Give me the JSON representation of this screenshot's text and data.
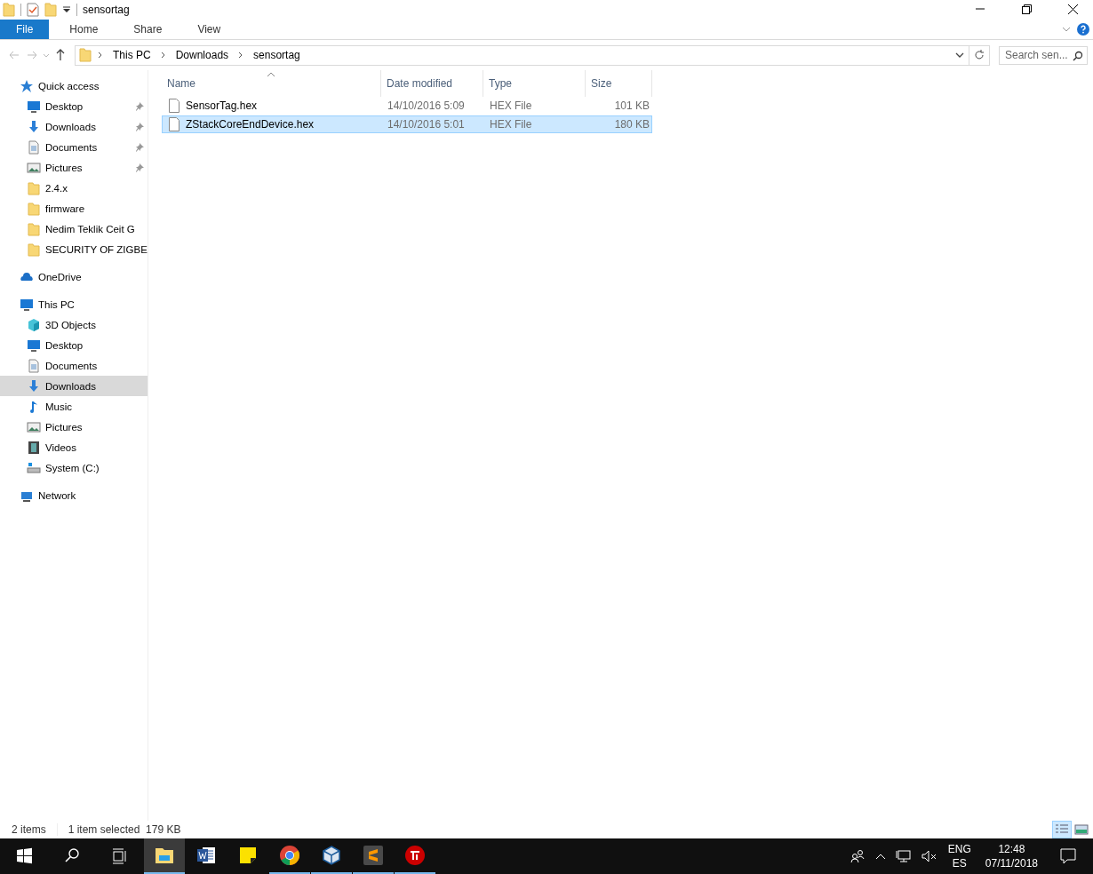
{
  "window": {
    "title": "sensortag"
  },
  "quick_access_toolbar": [
    {
      "kind": "properties"
    },
    {
      "kind": "new-folder"
    },
    {
      "kind": "customize"
    }
  ],
  "ribbon": {
    "tabs": [
      {
        "label": "File",
        "kind": "file",
        "selected": false
      },
      {
        "label": "Home",
        "kind": "tab",
        "selected": false
      },
      {
        "label": "Share",
        "kind": "tab",
        "selected": false
      },
      {
        "label": "View",
        "kind": "tab",
        "selected": false
      }
    ]
  },
  "address_bar": {
    "path": [
      "This PC",
      "Downloads",
      "sensortag"
    ]
  },
  "search": {
    "placeholder": "Search sen..."
  },
  "sidebar": {
    "items": [
      {
        "label": "Quick access",
        "kind": "star",
        "selected": false,
        "children": [
          {
            "label": "Desktop",
            "kind": "desktop",
            "pinned": true,
            "selected": false
          },
          {
            "label": "Downloads",
            "kind": "download",
            "pinned": true,
            "selected": false
          },
          {
            "label": "Documents",
            "kind": "document",
            "pinned": true,
            "selected": false
          },
          {
            "label": "Pictures",
            "kind": "picture",
            "pinned": true,
            "selected": false
          },
          {
            "label": "2.4.x",
            "kind": "folder",
            "pinned": false,
            "selected": false
          },
          {
            "label": "firmware",
            "kind": "folder",
            "pinned": false,
            "selected": false
          },
          {
            "label": "Nedim Teklik Ceit G",
            "kind": "folder",
            "pinned": false,
            "selected": false
          },
          {
            "label": "SECURITY OF ZIGBE",
            "kind": "folder",
            "pinned": false,
            "selected": false
          }
        ]
      },
      {
        "label": "OneDrive",
        "kind": "cloud",
        "selected": false
      },
      {
        "label": "This PC",
        "kind": "computer",
        "selected": false,
        "children": [
          {
            "label": "3D Objects",
            "kind": "cube",
            "selected": false
          },
          {
            "label": "Desktop",
            "kind": "desktop",
            "selected": false
          },
          {
            "label": "Documents",
            "kind": "document",
            "selected": false
          },
          {
            "label": "Downloads",
            "kind": "download",
            "selected": true
          },
          {
            "label": "Music",
            "kind": "music",
            "selected": false
          },
          {
            "label": "Pictures",
            "kind": "picture",
            "selected": false
          },
          {
            "label": "Videos",
            "kind": "video",
            "selected": false
          },
          {
            "label": "System (C:)",
            "kind": "drive",
            "selected": false
          }
        ]
      },
      {
        "label": "Network",
        "kind": "network",
        "selected": false
      }
    ]
  },
  "table": {
    "columns": [
      {
        "label": "Name",
        "sorted": true
      },
      {
        "label": "Date modified",
        "sorted": false
      },
      {
        "label": "Type",
        "sorted": false
      },
      {
        "label": "Size",
        "sorted": false
      }
    ],
    "rows": [
      {
        "name": "SensorTag.hex",
        "date": "14/10/2016 5:09",
        "type": "HEX File",
        "size": "101 KB",
        "selected": false
      },
      {
        "name": "ZStackCoreEndDevice.hex",
        "date": "14/10/2016 5:01",
        "type": "HEX File",
        "size": "180 KB",
        "selected": true
      }
    ]
  },
  "status_bar": {
    "count": "2 items",
    "selection": "1 item selected  179 KB",
    "views": [
      {
        "kind": "details",
        "selected": true
      },
      {
        "kind": "large-icons",
        "selected": false
      }
    ]
  },
  "taskbar": {
    "apps": [
      {
        "kind": "explorer",
        "selected": true,
        "running": true
      },
      {
        "kind": "word",
        "selected": false,
        "running": false
      },
      {
        "kind": "sticky",
        "selected": false,
        "running": false
      },
      {
        "kind": "chrome",
        "selected": false,
        "running": true
      },
      {
        "kind": "box",
        "selected": false,
        "running": true
      },
      {
        "kind": "sublime",
        "selected": false,
        "running": true
      },
      {
        "kind": "ti",
        "selected": false,
        "running": true
      }
    ],
    "language": "ENG",
    "layout": "ES",
    "time": "12:48",
    "date": "07/11/2018"
  }
}
